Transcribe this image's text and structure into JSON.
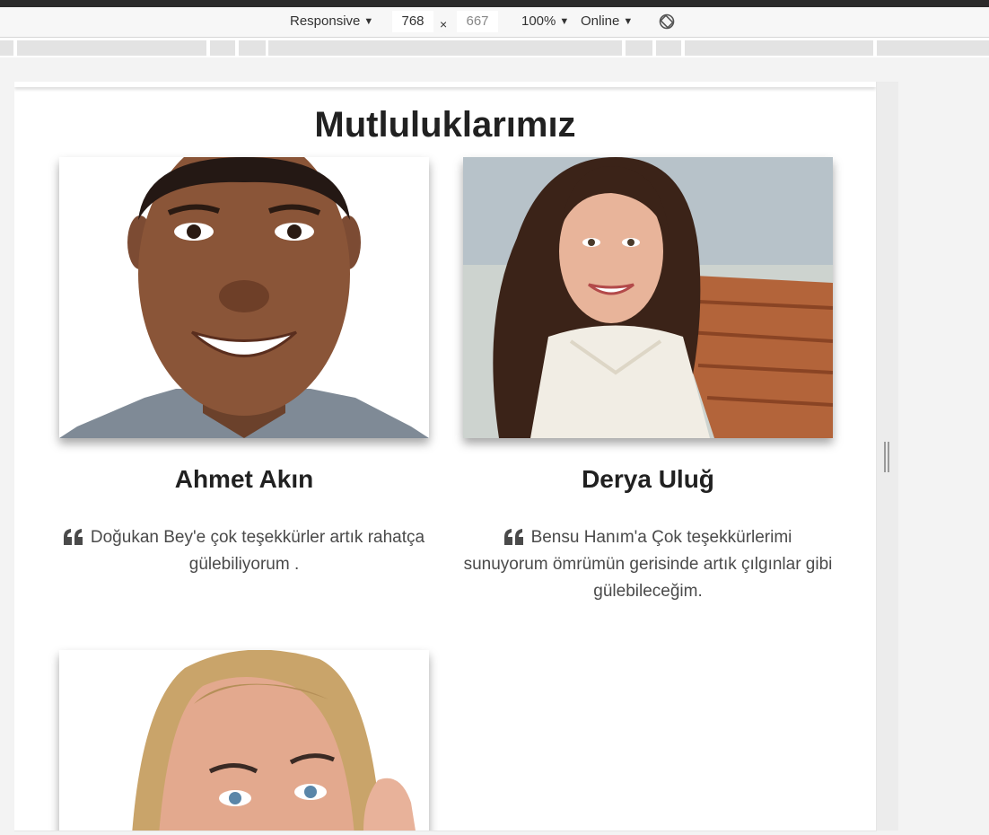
{
  "devtools": {
    "device_mode": "Responsive",
    "width": "768",
    "times": "×",
    "height": "667",
    "zoom": "100%",
    "throttle": "Online"
  },
  "page": {
    "section_title": "Mutluluklarımız",
    "testimonials": [
      {
        "name": "Ahmet Akın",
        "quote": "Doğukan Bey'e çok teşekkürler artık rahatça gülebiliyorum ."
      },
      {
        "name": "Derya Uluğ",
        "quote": "Bensu Hanım'a Çok teşekkürlerimi sunuyorum ömrümün gerisinde artık çılgınlar gibi gülebileceğim."
      },
      {
        "name": "",
        "quote": ""
      }
    ]
  },
  "icons": {
    "quote": "quote-left-icon",
    "rotate": "rotate-icon"
  }
}
